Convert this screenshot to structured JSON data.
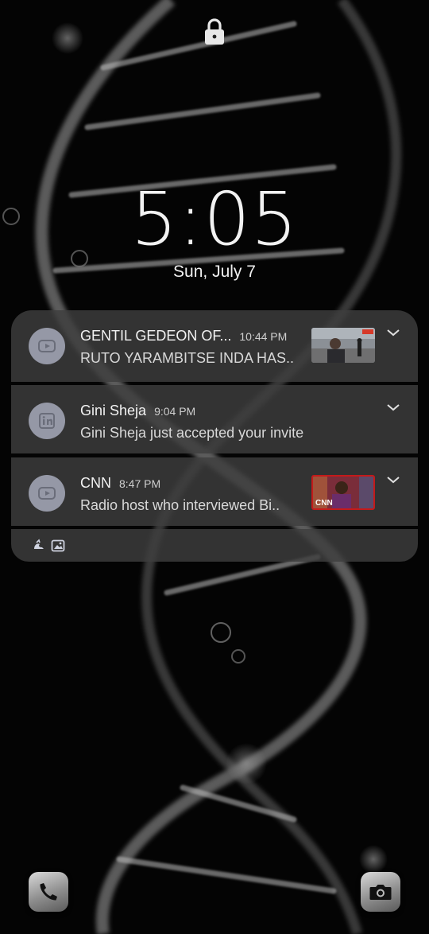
{
  "clock": {
    "time": "5:05",
    "date": "Sun, July 7"
  },
  "notifications": [
    {
      "app_icon": "youtube-icon",
      "sender": "GENTIL GEDEON OF...",
      "time": "10:44 PM",
      "body": "RUTO YARAMBITSE INDA HAS..",
      "thumbnail": "video-thumbnail"
    },
    {
      "app_icon": "linkedin-icon",
      "sender": "Gini Sheja",
      "time": "9:04 PM",
      "body": "Gini Sheja just accepted your invite"
    },
    {
      "app_icon": "youtube-icon",
      "sender": "CNN",
      "time": "8:47 PM",
      "body": "Radio host who interviewed Bi..",
      "thumbnail": "video-thumbnail",
      "thumbnail_text": "CNN"
    }
  ],
  "footer_icons": [
    "app-notification-icon",
    "image-icon"
  ],
  "shortcuts": {
    "left": "phone-icon",
    "right": "camera-icon"
  },
  "colors": {
    "card": "#3e3e3e",
    "app_icon_bg": "#9598a6",
    "cnn_red": "#c41a1a"
  }
}
